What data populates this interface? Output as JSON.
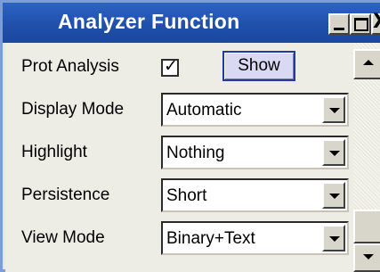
{
  "window": {
    "title": "Analyzer Function",
    "close_glyph": "X",
    "controls": [
      "minimize-icon",
      "maximize-icon",
      "close-icon"
    ]
  },
  "rows": [
    {
      "label": "Prot Analysis",
      "checkbox_checked": true,
      "check_glyph": "✓",
      "button_label": "Show"
    },
    {
      "label": "Display Mode",
      "value": "Automatic"
    },
    {
      "label": "Highlight",
      "value": "Nothing"
    },
    {
      "label": "Persistence",
      "value": "Short"
    },
    {
      "label": "View Mode",
      "value": "Binary+Text"
    }
  ],
  "icons": {
    "dropdown": "chevron-down-icon",
    "scroll_up": "scroll-up-arrow-icon",
    "scroll_down": "scroll-down-arrow-icon"
  },
  "colors": {
    "titlebar": "#1f4fa8",
    "title_text": "#ffffff",
    "panel_bg": "#eeede5",
    "show_button_bg": "#d9d9f3",
    "show_button_border": "#1f3aa8"
  }
}
